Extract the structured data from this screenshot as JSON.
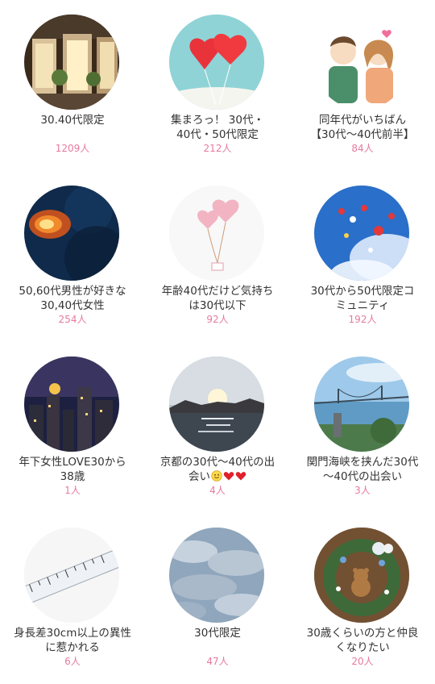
{
  "accent_color": "#e67aa0",
  "communities": [
    {
      "title_lines": [
        "30.40代限定"
      ],
      "members": "1209人",
      "image": "lit-shopfront-photo"
    },
    {
      "title_lines": [
        "集まろっ！ 30代・",
        "40代・50代限定"
      ],
      "members": "212人",
      "image": "red-heart-balloons-photo"
    },
    {
      "title_lines": [
        "同年代がいちばん",
        "【30代〜40代前半】"
      ],
      "members": "84人",
      "image": "couple-illustration"
    },
    {
      "title_lines": [
        "50,60代男性が好きな",
        "30,40代女性"
      ],
      "members": "254人",
      "image": "fire-in-night-sky-photo"
    },
    {
      "title_lines": [
        "年齢40代だけど気持ち",
        "は30代以下"
      ],
      "members": "92人",
      "image": "pink-heart-balloons-illustration"
    },
    {
      "title_lines": [
        "30代から50代限定コ",
        "ミュニティ"
      ],
      "members": "192人",
      "image": "balloons-blue-sky-photo"
    },
    {
      "title_lines": [
        "年下女性LOVE30から",
        "38歳"
      ],
      "members": "1人",
      "image": "city-night-moon-photo"
    },
    {
      "title_lines": [
        "京都の30代〜40代の出",
        "会い"
      ],
      "title_emoji": [
        "smiley-emoji",
        "red-heart-emoji",
        "red-heart-emoji"
      ],
      "members": "4人",
      "image": "sunset-lake-photo"
    },
    {
      "title_lines": [
        "関門海峡を挟んだ30代",
        "〜40代の出会い"
      ],
      "members": "3人",
      "image": "kanmon-bridge-photo"
    },
    {
      "title_lines": [
        "身長差30cm以上の異性",
        "に惹かれる"
      ],
      "members": "6人",
      "image": "ruler-photo"
    },
    {
      "title_lines": [
        "30代限定"
      ],
      "members": "47人",
      "image": "cloudy-sky-photo"
    },
    {
      "title_lines": [
        "30歳くらいの方と仲良",
        "くなりたい"
      ],
      "members": "20人",
      "image": "wreath-teddy-bear-photo"
    }
  ]
}
